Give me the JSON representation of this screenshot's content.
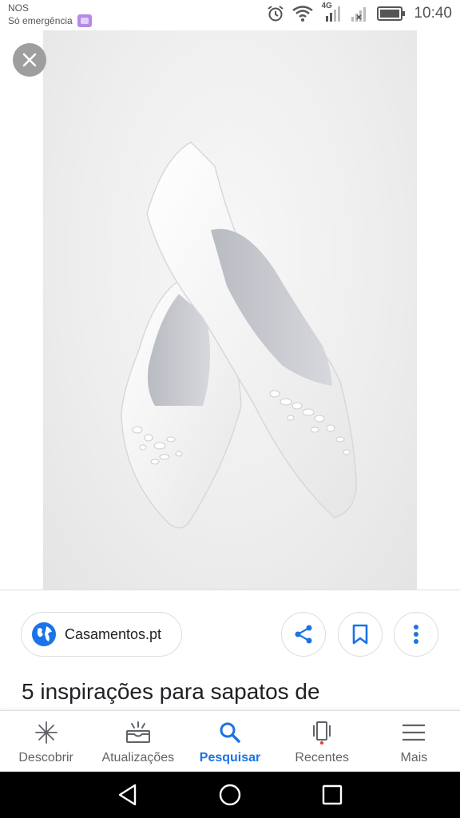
{
  "status_bar": {
    "carrier": "NOS",
    "emergency": "Só emergência",
    "network": "4G",
    "time": "10:40",
    "icons": [
      "sim-icon",
      "alarm-icon",
      "wifi-icon",
      "signal-icon",
      "signal-no-service-icon",
      "battery-icon"
    ]
  },
  "viewer": {
    "close_icon": "close-icon",
    "image_subject": "wedding-shoes-photo"
  },
  "source": {
    "name": "Casamentos.pt",
    "icon": "globe-icon"
  },
  "actions": {
    "share_icon": "share-icon",
    "bookmark_icon": "bookmark-icon",
    "more_icon": "more-vert-icon"
  },
  "result": {
    "title": "5 inspirações para sapatos de"
  },
  "bottom_nav": {
    "items": [
      {
        "label": "Descobrir",
        "icon": "asterisk-icon",
        "active": false
      },
      {
        "label": "Atualizações",
        "icon": "updates-icon",
        "active": false
      },
      {
        "label": "Pesquisar",
        "icon": "search-icon",
        "active": true
      },
      {
        "label": "Recentes",
        "icon": "recents-icon",
        "active": false
      },
      {
        "label": "Mais",
        "icon": "menu-icon",
        "active": false
      }
    ]
  },
  "colors": {
    "accent": "#1a73e8",
    "nav_label": "#5f6368",
    "recent_dot": "#ea4335"
  }
}
